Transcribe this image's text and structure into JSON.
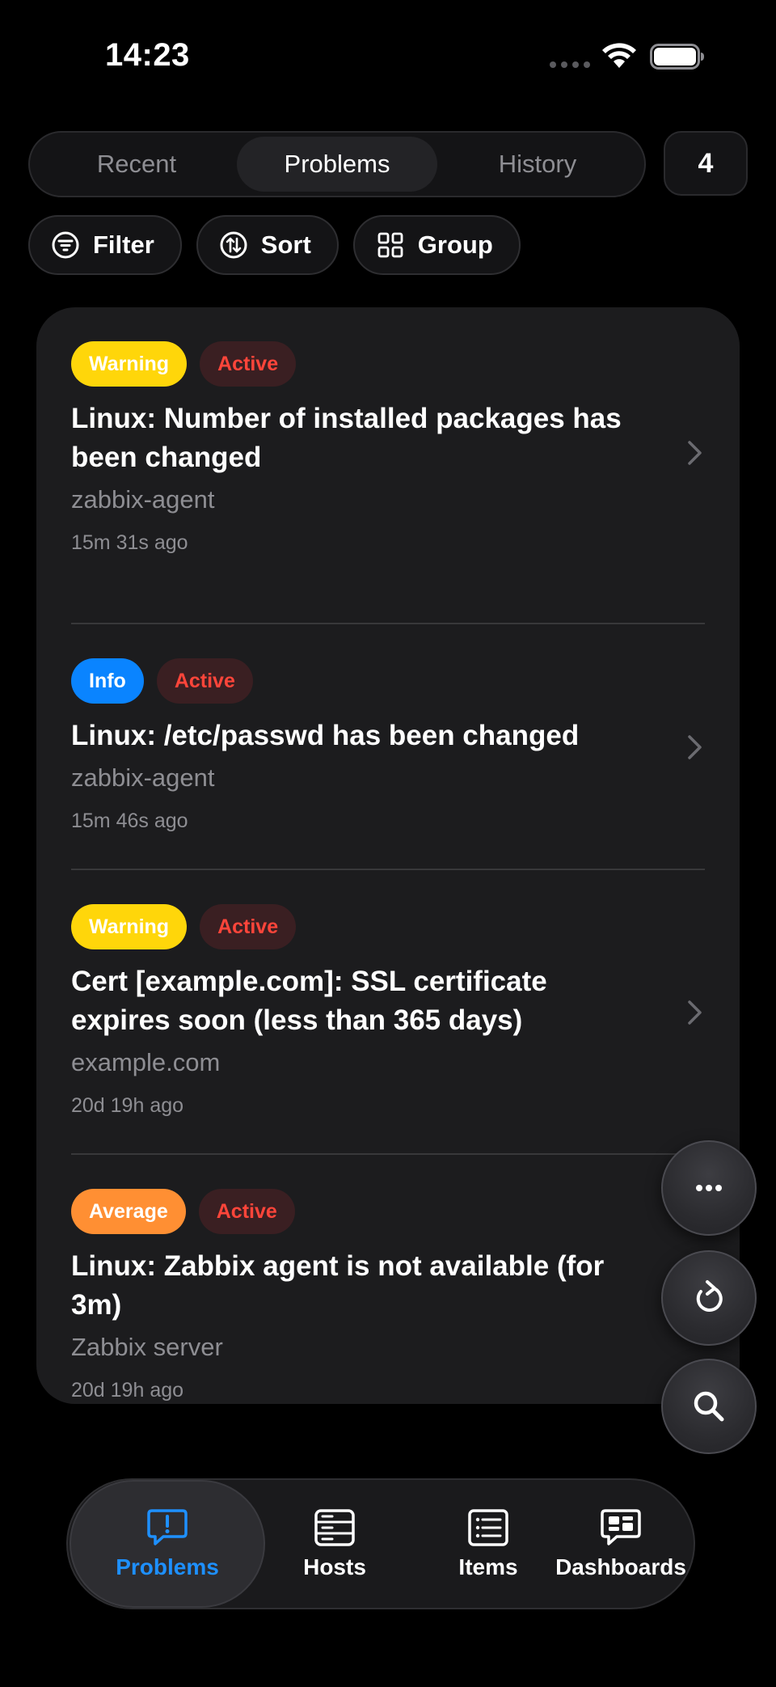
{
  "status_bar": {
    "time": "14:23"
  },
  "segments": [
    {
      "label": "Recent",
      "active": false
    },
    {
      "label": "Problems",
      "active": true
    },
    {
      "label": "History",
      "active": false
    }
  ],
  "count": "4",
  "chips": {
    "filter": "Filter",
    "sort": "Sort",
    "group": "Group"
  },
  "problems": [
    {
      "severity": "Warning",
      "status": "Active",
      "title": "Linux: Number of installed packages has been changed",
      "host": "zabbix-agent",
      "ago": "15m 31s ago"
    },
    {
      "severity": "Info",
      "status": "Active",
      "title": "Linux: /etc/passwd has been changed",
      "host": "zabbix-agent",
      "ago": "15m 46s ago"
    },
    {
      "severity": "Warning",
      "status": "Active",
      "title": "Cert [example.com]: SSL certificate expires soon (less than 365 days)",
      "host": "example.com",
      "ago": "20d 19h ago"
    },
    {
      "severity": "Average",
      "status": "Active",
      "title": "Linux: Zabbix agent is not available (for 3m)",
      "host": "Zabbix server",
      "ago": "20d 19h ago"
    }
  ],
  "severity_colors": {
    "Warning": "#ffd60a",
    "Info": "#0a84ff",
    "Average": "#ff8f33"
  },
  "status_color": "#ff453a",
  "fabs": [
    "more-icon",
    "refresh-icon",
    "search-icon"
  ],
  "tabs": [
    {
      "label": "Problems",
      "icon": "exclamation-bubble-icon",
      "active": true
    },
    {
      "label": "Hosts",
      "icon": "server-icon",
      "active": false
    },
    {
      "label": "Items",
      "icon": "list-icon",
      "active": false
    },
    {
      "label": "Dashboards",
      "icon": "dashboard-bubble-icon",
      "active": false
    }
  ],
  "accent_color": "#1e90ff"
}
